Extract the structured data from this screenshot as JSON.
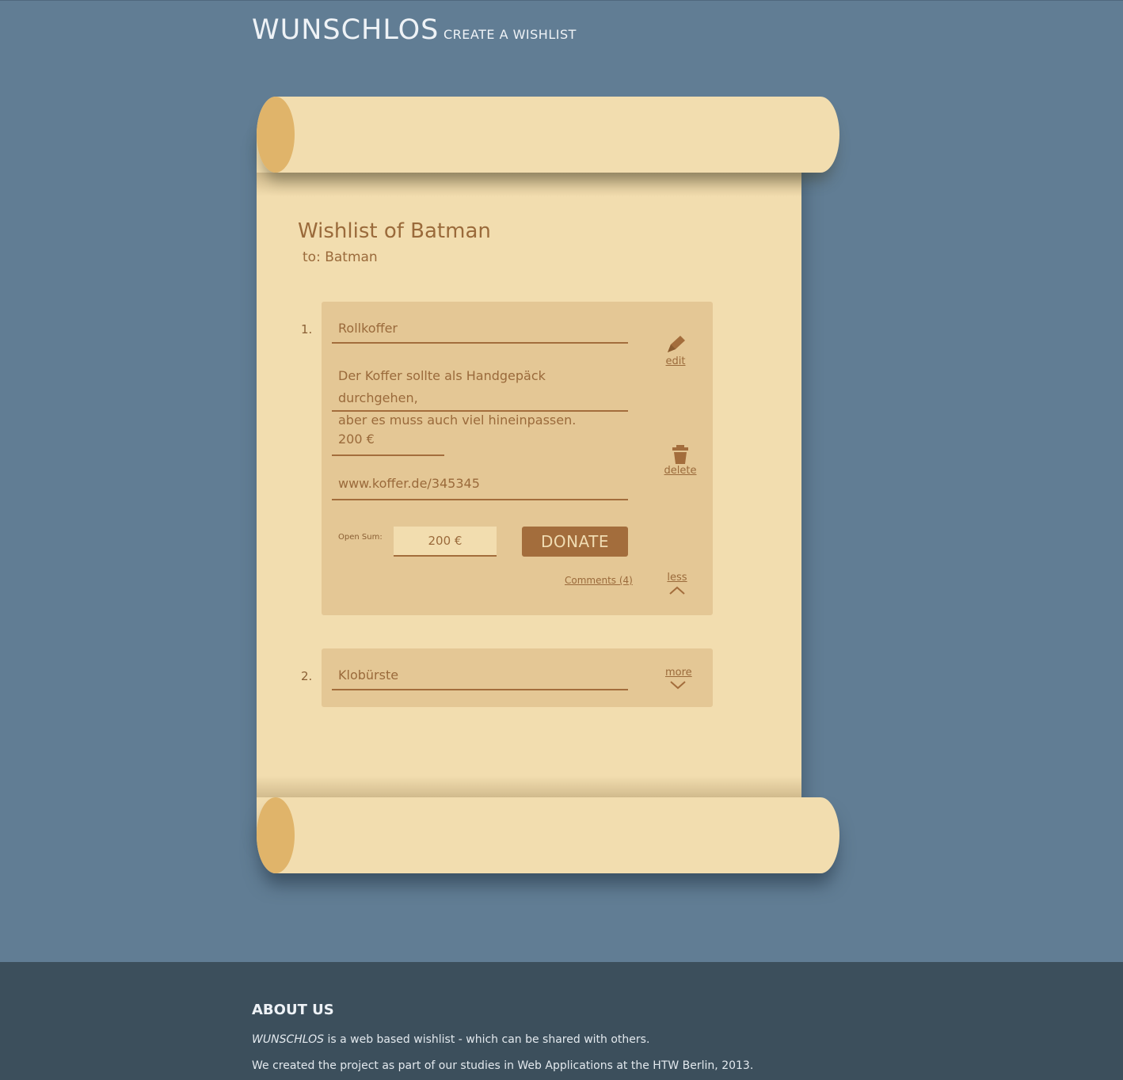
{
  "header": {
    "brand": "WUNSCHLOS",
    "create_link": "CREATE A WISHLIST"
  },
  "wishlist": {
    "title": "Wishlist of Batman",
    "to": "to: Batman",
    "items": [
      {
        "number": "1.",
        "title": "Rollkoffer",
        "description_line1": "Der Koffer sollte als Handgepäck durchgehen,",
        "description_line2": "aber es muss auch viel hineinpassen.",
        "price": "200 €",
        "url": "www.koffer.de/345345",
        "open_sum_label": "Open Sum:",
        "open_sum_value": "200 €",
        "donate_label": "DONATE",
        "comments_label": "Comments (4)",
        "edit_label": "edit",
        "delete_label": "delete",
        "toggle_label": "less"
      },
      {
        "number": "2.",
        "title": "Klobürste",
        "toggle_label": "more"
      }
    ]
  },
  "footer": {
    "title": "ABOUT US",
    "line1_brand": "WUNSCHLOS",
    "line1_rest": " is a web based wishlist - which can be shared with others.",
    "line2": "We created the project as part of our studies in Web Applications at the HTW Berlin, 2013."
  },
  "colors": {
    "background": "#617d94",
    "paper": "#f2ddaf",
    "card": "#e4c795",
    "accent": "#a36d3c",
    "footer": "#3c4f5c"
  },
  "icons": {
    "edit": "pencil-icon",
    "delete": "trash-icon",
    "less": "chevron-up-icon",
    "more": "chevron-down-icon"
  }
}
